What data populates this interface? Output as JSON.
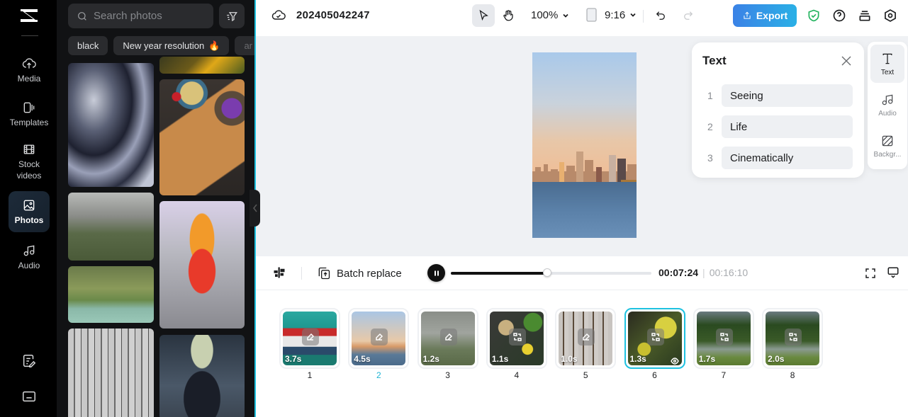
{
  "rail": {
    "logo": "capcut-logo",
    "items": [
      {
        "label": "Media",
        "icon": "cloud-upload-icon",
        "active": false
      },
      {
        "label": "Templates",
        "icon": "templates-icon",
        "active": false
      },
      {
        "label": "Stock\nvideos",
        "icon": "film-icon",
        "active": false
      },
      {
        "label": "Photos",
        "icon": "image-icon",
        "active": true
      },
      {
        "label": "Audio",
        "icon": "music-note-icon",
        "active": false
      }
    ],
    "bottom": [
      "edit-document-icon",
      "keyboard-icon"
    ]
  },
  "panel": {
    "search_placeholder": "Search photos",
    "chips": [
      "black",
      "New year resolution",
      "ar"
    ],
    "photos": [
      "Black silk fabric",
      "Autumn forest aerial",
      "Tacos on wooden board",
      "Cliffside monastery in fog",
      "Orange-haired cosplayer",
      "Suspension bridge over river",
      "Foggy bare trees",
      "Man holding up banknote"
    ]
  },
  "topbar": {
    "project_name": "202405042247",
    "zoom": "100%",
    "ratio": "9:16",
    "export_label": "Export"
  },
  "text_panel": {
    "title": "Text",
    "items": [
      {
        "num": "1",
        "value": "Seeing"
      },
      {
        "num": "2",
        "value": "Life"
      },
      {
        "num": "3",
        "value": "Cinematically"
      }
    ]
  },
  "side_tabs": [
    {
      "label": "Text",
      "active": true
    },
    {
      "label": "Audio",
      "active": false
    },
    {
      "label": "Backgr...",
      "active": false
    }
  ],
  "timeline": {
    "batch_label": "Batch replace",
    "current_time": "00:07:24",
    "total_time": "00:16:10",
    "progress": 0.48
  },
  "clips": [
    {
      "num": "1",
      "duration": "3.7s",
      "action": "edit",
      "selected": false,
      "active_num": false
    },
    {
      "num": "2",
      "duration": "4.5s",
      "action": "edit",
      "selected": false,
      "active_num": true
    },
    {
      "num": "3",
      "duration": "1.2s",
      "action": "edit",
      "selected": false,
      "active_num": false
    },
    {
      "num": "4",
      "duration": "1.1s",
      "action": "replace",
      "selected": false,
      "active_num": false
    },
    {
      "num": "5",
      "duration": "1.0s",
      "action": "edit",
      "selected": false,
      "active_num": false
    },
    {
      "num": "6",
      "duration": "1.3s",
      "action": "replace",
      "selected": true,
      "active_num": false
    },
    {
      "num": "7",
      "duration": "1.7s",
      "action": "replace",
      "selected": false,
      "active_num": false
    },
    {
      "num": "8",
      "duration": "2.0s",
      "action": "replace",
      "selected": false,
      "active_num": false
    }
  ],
  "colors": {
    "accent": "#1fc2e0",
    "export_start": "#3b82e6",
    "export_end": "#2ab0e6",
    "shield": "#22b35e"
  }
}
